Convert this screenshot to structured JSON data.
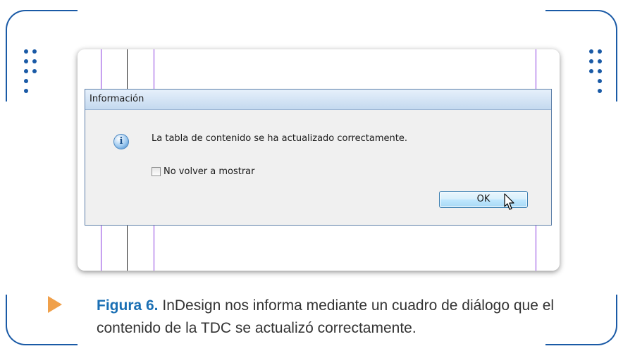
{
  "dialog": {
    "title": "Información",
    "icon": "info-icon",
    "message": "La tabla de contenido se ha actualizado correctamente.",
    "checkbox_label": "No volver a mostrar",
    "checkbox_checked": false,
    "ok_label": "OK"
  },
  "caption": {
    "label": "Figura 6.",
    "text": " InDesign nos informa mediante un cuadro de diálogo que el contenido de la TDC se actualizó correctamente."
  },
  "colors": {
    "frame": "#1a5aa6",
    "caption_label": "#1a6fb4",
    "arrow": "#f0a04a",
    "guide_purple": "#8a3be0",
    "guide_black": "#222222"
  }
}
